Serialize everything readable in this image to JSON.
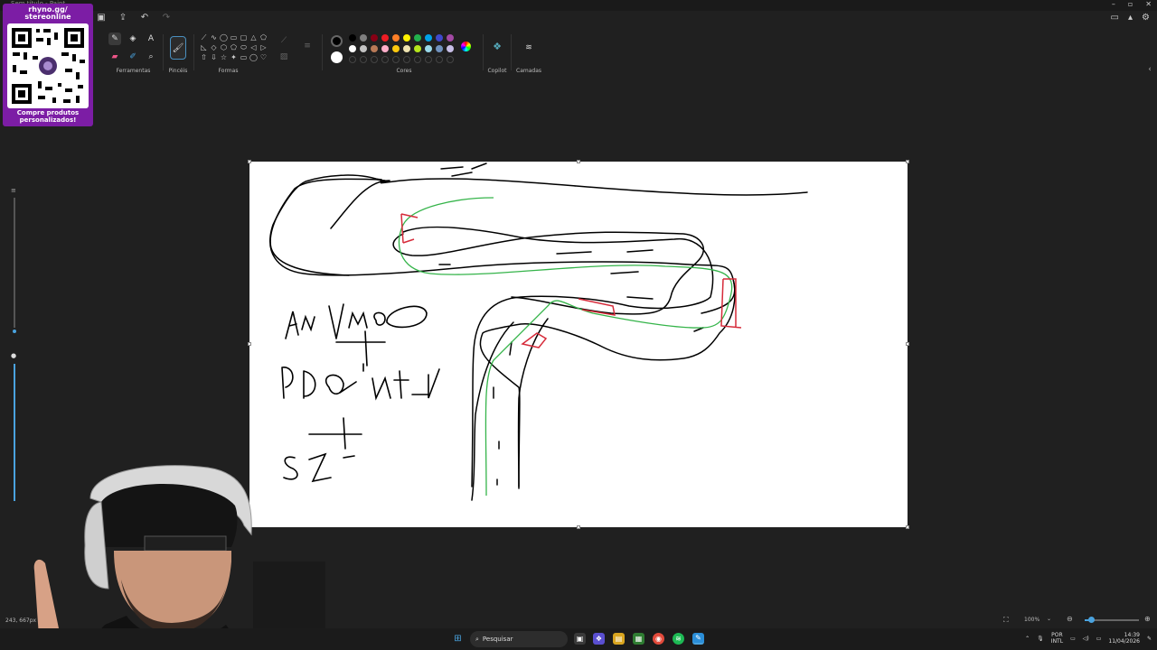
{
  "window": {
    "title": "Sem título - Paint"
  },
  "quick_access": {
    "save_icon": "save-icon",
    "share_icon": "share-icon",
    "undo_icon": "undo-icon",
    "redo_icon": "redo-icon"
  },
  "ribbon": {
    "groups": {
      "tools": "Ferramentas",
      "brushes": "Pincéis",
      "shapes": "Formas",
      "colors": "Cores",
      "copilot": "Copilot",
      "layers": "Camadas"
    },
    "shape_glyphs": [
      "⟋",
      "∿",
      "◯",
      "▭",
      "▢",
      "△",
      "⬠",
      "◺",
      "◇",
      "⬡",
      "⬠",
      "⬭",
      "◁",
      "▷",
      "⇧",
      "⇩",
      "☆",
      "✦",
      "▭",
      "◯",
      "♡"
    ],
    "colors_row1": [
      "#000000",
      "#7f7f7f",
      "#880015",
      "#ed1c24",
      "#ff7f27",
      "#fff200",
      "#22b14c",
      "#00a2e8",
      "#3f48cc",
      "#a349a4"
    ],
    "colors_row2": [
      "#ffffff",
      "#c3c3c3",
      "#b97a57",
      "#ffaec9",
      "#ffc90e",
      "#efe4b0",
      "#b5e61d",
      "#99d9ea",
      "#7092be",
      "#c8bfe7"
    ],
    "primary_color": "#000000",
    "secondary_color": "#ffffff"
  },
  "qr_overlay": {
    "top_line1": "rhyno.gg/",
    "top_line2": "stereonline",
    "bottom_line1": "Compre produtos",
    "bottom_line2": "personalizados!"
  },
  "canvas": {
    "handwriting": {
      "line1": "ANYMO",
      "line2": "PDQ INTL",
      "line3": "SZ"
    }
  },
  "status": {
    "coords": "243, 667px",
    "zoom": "100%",
    "zoom_level": 0.12
  },
  "taskbar": {
    "search_placeholder": "Pesquisar",
    "lang_line1": "POR",
    "lang_line2": "INTL",
    "time": "14:39",
    "date": "11/04/2026"
  }
}
